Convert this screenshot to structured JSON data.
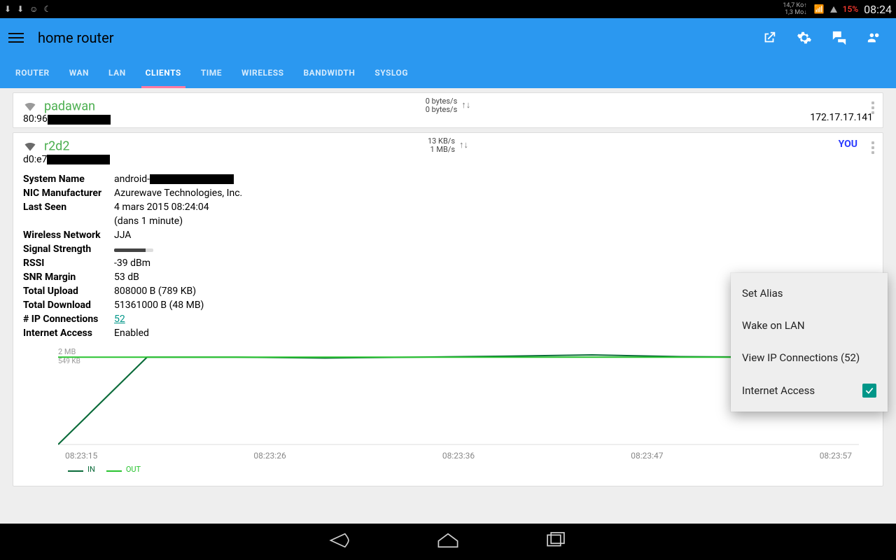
{
  "statusbar": {
    "speed_up": "14,7 Ko",
    "speed_down": "1,3 Mo",
    "battery": "15%",
    "clock": "08:24"
  },
  "appbar": {
    "title": "home router"
  },
  "tabs": [
    "ROUTER",
    "WAN",
    "LAN",
    "CLIENTS",
    "TIME",
    "WIRELESS",
    "BANDWIDTH",
    "SYSLOG"
  ],
  "active_tab": "CLIENTS",
  "clients": {
    "padawan": {
      "name": "padawan",
      "mac_prefix": "80:96",
      "up": "0 bytes/s",
      "down": "0 bytes/s",
      "ip": "172.17.17.141"
    },
    "r2d2": {
      "name": "r2d2",
      "mac_prefix": "d0:e7",
      "up": "13 KB/s",
      "down": "1 MB/s",
      "you": "YOU",
      "system_name_prefix": "android-",
      "nic_manufacturer": "Azurewave Technologies, Inc.",
      "last_seen_line1": "4 mars 2015 08:24:04",
      "last_seen_line2": "(dans 1 minute)",
      "wireless_network": "JJA",
      "rssi": "-39 dBm",
      "snr_margin": "53 dB",
      "total_upload": "808000 B (789 KB)",
      "total_download": "51361000 B (48 MB)",
      "ip_connections": "52",
      "internet_access": "Enabled"
    }
  },
  "labels": {
    "system_name": "System Name",
    "nic_manufacturer": "NIC Manufacturer",
    "last_seen": "Last Seen",
    "wireless_network": "Wireless Network",
    "signal_strength": "Signal Strength",
    "rssi": "RSSI",
    "snr_margin": "SNR Margin",
    "total_upload": "Total Upload",
    "total_download": "Total Download",
    "ip_connections": "# IP Connections",
    "internet_access": "Internet Access"
  },
  "chart_data": {
    "type": "line",
    "xlabel": "",
    "ylabel": "",
    "x_ticks": [
      "08:23:15",
      "08:23:26",
      "08:23:36",
      "08:23:47",
      "08:23:57"
    ],
    "y_label_top": "2 MB",
    "y_label_top2": "549 KB",
    "series": [
      {
        "name": "IN",
        "color": "#0b6b3a",
        "values": [
          0,
          1.92,
          1.92,
          1.9,
          1.92,
          1.94,
          1.97,
          1.93,
          1.92,
          1.92
        ]
      },
      {
        "name": "OUT",
        "color": "#28c32f",
        "values": [
          1.92,
          1.92,
          1.92,
          1.92,
          1.92,
          1.92,
          1.92,
          1.92,
          1.92,
          1.92
        ]
      }
    ],
    "ylim": [
      0,
      2
    ]
  },
  "menu": {
    "set_alias": "Set Alias",
    "wake_on_lan": "Wake on LAN",
    "view_ip_connections": "View IP Connections (52)",
    "internet_access": "Internet Access",
    "internet_access_checked": true
  },
  "legend": {
    "in": "IN",
    "out": "OUT"
  }
}
